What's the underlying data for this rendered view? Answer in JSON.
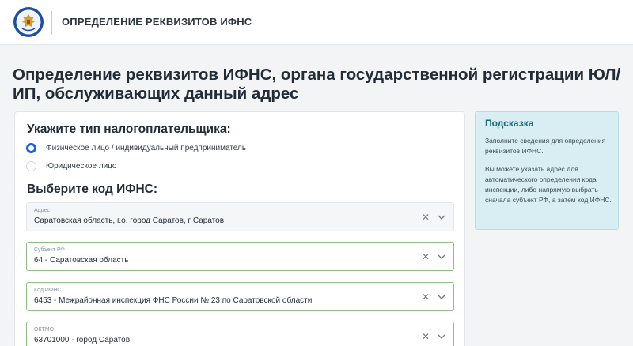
{
  "header": {
    "title": "ОПРЕДЕЛЕНИЕ РЕКВИЗИТОВ ИФНС"
  },
  "page": {
    "heading": "Определение реквизитов ИФНС, органа государственной регистрации ЮЛ/ИП, обслуживающих данный адрес"
  },
  "form": {
    "taxpayer_type_title": "Укажите тип налогоплательщика:",
    "taxpayer_types": [
      {
        "label": "Физическое лицо / индивидуальный предприниматель",
        "checked": true
      },
      {
        "label": "Юридическое лицо",
        "checked": false
      }
    ],
    "ifns_title": "Выберите код ИФНС:",
    "fields": [
      {
        "label": "Адрес",
        "value": "Саратовская область, г.о. город Саратов, г Саратов"
      },
      {
        "label": "Субъект РФ",
        "value": "64 - Саратовская область"
      },
      {
        "label": "Код ИФНС",
        "value": "6453 - Межрайонная инспекция ФНС России № 23 по Саратовской области"
      },
      {
        "label": "ОКТМО",
        "value": "63701000 - город Саратов"
      }
    ],
    "clear_symbol": "✕"
  },
  "hint": {
    "title": "Подсказка",
    "paragraphs": [
      "Заполните сведения для определения реквизитов ИФНС.",
      "Вы можете указать адрес для автоматического определения кода инспекции, либо напрямую выбрать сначала субъект РФ, а затем код ИФНС."
    ]
  },
  "colors": {
    "accent": "#1b63d6",
    "valid_border": "#8dbf84",
    "hint_background": "#d8eef2",
    "hint_title": "#1c6a7c"
  },
  "icons": {
    "logo": "fns-emblem-icon",
    "clear": "close-icon",
    "dropdown": "chevron-down-icon"
  }
}
